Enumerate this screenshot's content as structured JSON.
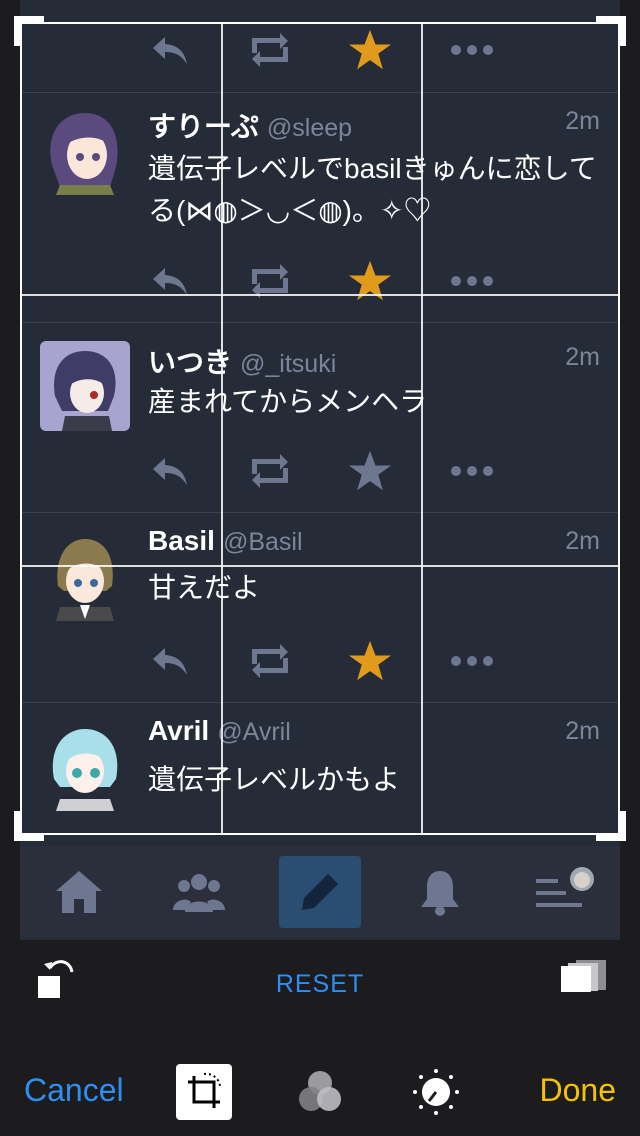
{
  "tweets": [
    {
      "name": "すりーぷ",
      "handle": "@sleep",
      "time": "2m",
      "text": "遺伝子レベルでbasilきゅんに恋してる(⋈◍＞◡＜◍)。✧♡",
      "favorited": true
    },
    {
      "name": "いつき",
      "handle": "@_itsuki",
      "time": "2m",
      "text": "産まれてからメンヘラ",
      "favorited": false
    },
    {
      "name": "Basil",
      "handle": "@Basil",
      "time": "2m",
      "text": "甘えだよ",
      "favorited": true
    },
    {
      "name": "Avril",
      "handle": "@Avril",
      "time": "2m",
      "text": "遺伝子レベルかもよ",
      "favorited": false
    }
  ],
  "tabbar": [
    "home-icon",
    "people-icon",
    "compose-icon",
    "bell-icon",
    "menu-list-icon"
  ],
  "toolbar": {
    "reset_label": "RESET",
    "cancel_label": "Cancel",
    "done_label": "Done"
  },
  "colors": {
    "accent_blue": "#2e8ff0",
    "done_yellow": "#f3c00c",
    "favorite": "#e09a1c",
    "background": "#262b38"
  }
}
